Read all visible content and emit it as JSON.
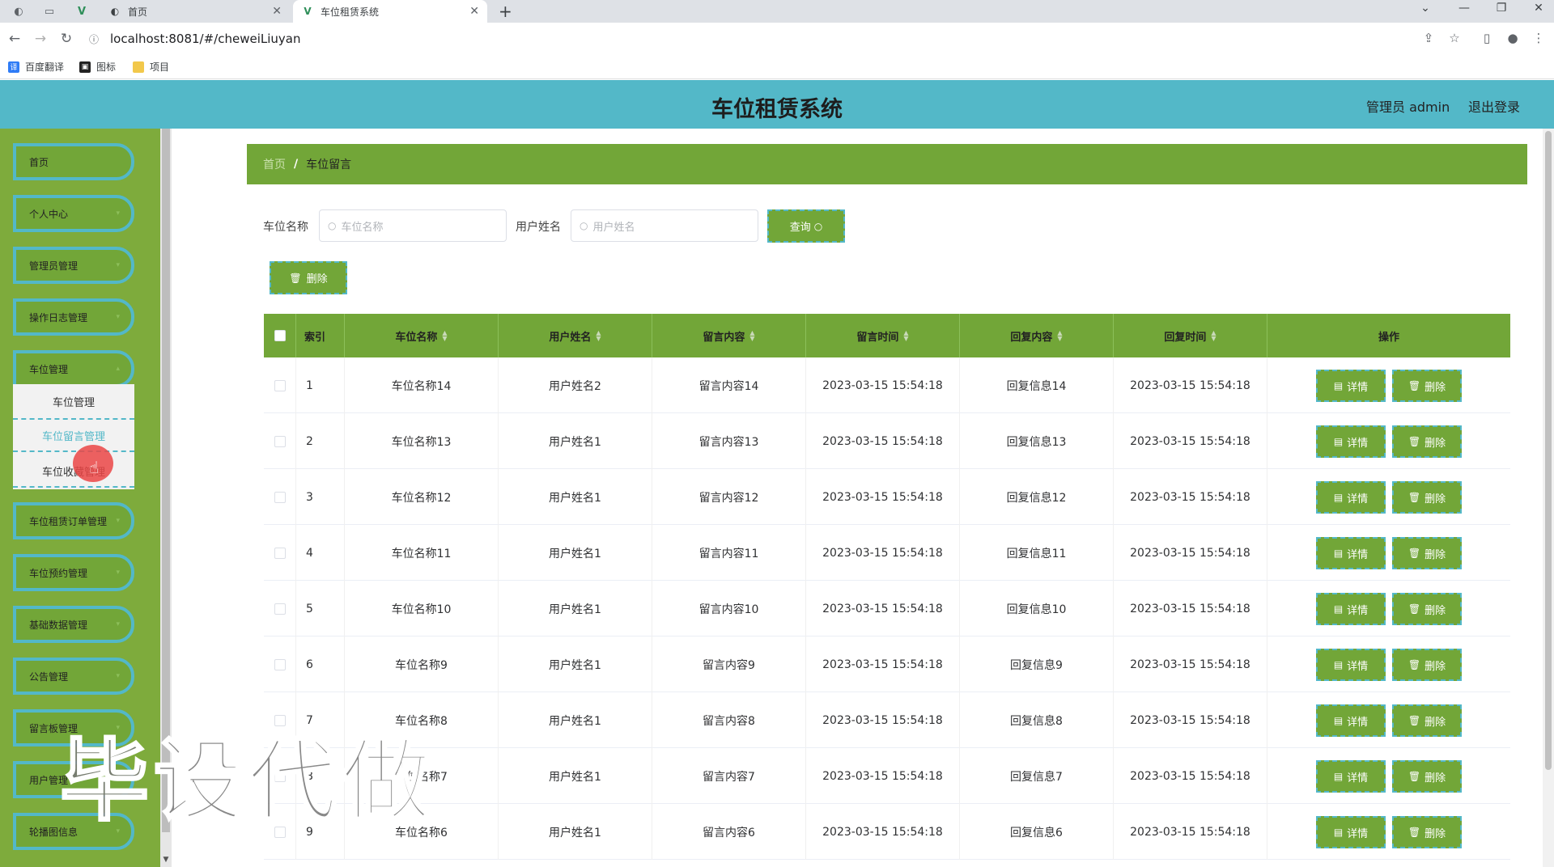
{
  "browser": {
    "tabs": [
      {
        "label": "首页",
        "close": "✕"
      },
      {
        "label": "车位租赁系统",
        "close": "✕"
      }
    ],
    "new_tab": "+",
    "url": "localhost:8081/#/cheweiLiuyan",
    "bookmarks": [
      "百度翻译",
      "图标",
      "项目"
    ]
  },
  "header": {
    "title": "车位租赁系统",
    "user": "管理员 admin",
    "logout": "退出登录"
  },
  "sidebar": {
    "items": [
      {
        "label": "首页"
      },
      {
        "label": "个人中心"
      },
      {
        "label": "管理员管理"
      },
      {
        "label": "操作日志管理"
      },
      {
        "label": "车位管理"
      },
      {
        "label": "车位租赁订单管理"
      },
      {
        "label": "车位预约管理"
      },
      {
        "label": "基础数据管理"
      },
      {
        "label": "公告管理"
      },
      {
        "label": "留言板管理"
      },
      {
        "label": "用户管理"
      },
      {
        "label": "轮播图信息"
      }
    ],
    "submenu": [
      {
        "label": "车位管理"
      },
      {
        "label": "车位留言管理"
      },
      {
        "label": "车位收藏管理"
      }
    ]
  },
  "breadcrumb": {
    "home": "首页",
    "separator": "/",
    "current": "车位留言"
  },
  "search": {
    "field1_label": "车位名称",
    "field1_placeholder": "车位名称",
    "field2_label": "用户姓名",
    "field2_placeholder": "用户姓名",
    "query_button": "查询"
  },
  "toolbar": {
    "delete_button": "删除"
  },
  "table": {
    "columns": [
      "索引",
      "车位名称",
      "用户姓名",
      "留言内容",
      "留言时间",
      "回复内容",
      "回复时间",
      "操作"
    ],
    "detail_label": "详情",
    "delete_label": "删除",
    "rows": [
      {
        "index": "1",
        "name": "车位名称14",
        "user": "用户姓名2",
        "content": "留言内容14",
        "time": "2023-03-15 15:54:18",
        "reply": "回复信息14",
        "reply_time": "2023-03-15 15:54:18"
      },
      {
        "index": "2",
        "name": "车位名称13",
        "user": "用户姓名1",
        "content": "留言内容13",
        "time": "2023-03-15 15:54:18",
        "reply": "回复信息13",
        "reply_time": "2023-03-15 15:54:18"
      },
      {
        "index": "3",
        "name": "车位名称12",
        "user": "用户姓名1",
        "content": "留言内容12",
        "time": "2023-03-15 15:54:18",
        "reply": "回复信息12",
        "reply_time": "2023-03-15 15:54:18"
      },
      {
        "index": "4",
        "name": "车位名称11",
        "user": "用户姓名1",
        "content": "留言内容11",
        "time": "2023-03-15 15:54:18",
        "reply": "回复信息11",
        "reply_time": "2023-03-15 15:54:18"
      },
      {
        "index": "5",
        "name": "车位名称10",
        "user": "用户姓名1",
        "content": "留言内容10",
        "time": "2023-03-15 15:54:18",
        "reply": "回复信息10",
        "reply_time": "2023-03-15 15:54:18"
      },
      {
        "index": "6",
        "name": "车位名称9",
        "user": "用户姓名1",
        "content": "留言内容9",
        "time": "2023-03-15 15:54:18",
        "reply": "回复信息9",
        "reply_time": "2023-03-15 15:54:18"
      },
      {
        "index": "7",
        "name": "车位名称8",
        "user": "用户姓名1",
        "content": "留言内容8",
        "time": "2023-03-15 15:54:18",
        "reply": "回复信息8",
        "reply_time": "2023-03-15 15:54:18"
      },
      {
        "index": "8",
        "name": "车位名称7",
        "user": "用户姓名1",
        "content": "留言内容7",
        "time": "2023-03-15 15:54:18",
        "reply": "回复信息7",
        "reply_time": "2023-03-15 15:54:18"
      },
      {
        "index": "9",
        "name": "车位名称6",
        "user": "用户姓名1",
        "content": "留言内容6",
        "time": "2023-03-15 15:54:18",
        "reply": "回复信息6",
        "reply_time": "2023-03-15 15:54:18"
      }
    ]
  },
  "watermark": "毕设代做",
  "colors": {
    "header": "#53b8c8",
    "sidebar": "#7eab3c",
    "accent": "#72a638",
    "dash_border": "#53b8c8"
  }
}
